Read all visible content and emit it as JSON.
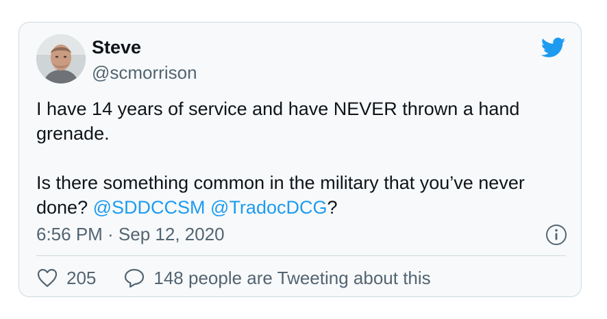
{
  "author": {
    "name": "Steve",
    "handle": "@scmorrison"
  },
  "tweet": {
    "line1": "I have 14 years of service and have NEVER thrown a hand grenade.",
    "line2_prefix": "Is there something common in the military that you’ve never done? ",
    "mention1": "@SDDCCSM",
    "mention_sep": " ",
    "mention2": "@TradocDCG",
    "line2_suffix": "?"
  },
  "meta": {
    "timestamp": "6:56 PM · Sep 12, 2020"
  },
  "actions": {
    "like_count": "205",
    "reply_text": "148 people are Tweeting about this"
  },
  "colors": {
    "accent": "#1d9bf0",
    "muted": "#536471",
    "text": "#0f1419"
  },
  "icons": {
    "brand": "twitter-bird-icon",
    "info": "info-icon",
    "like": "heart-icon",
    "reply": "speech-bubble-icon"
  }
}
